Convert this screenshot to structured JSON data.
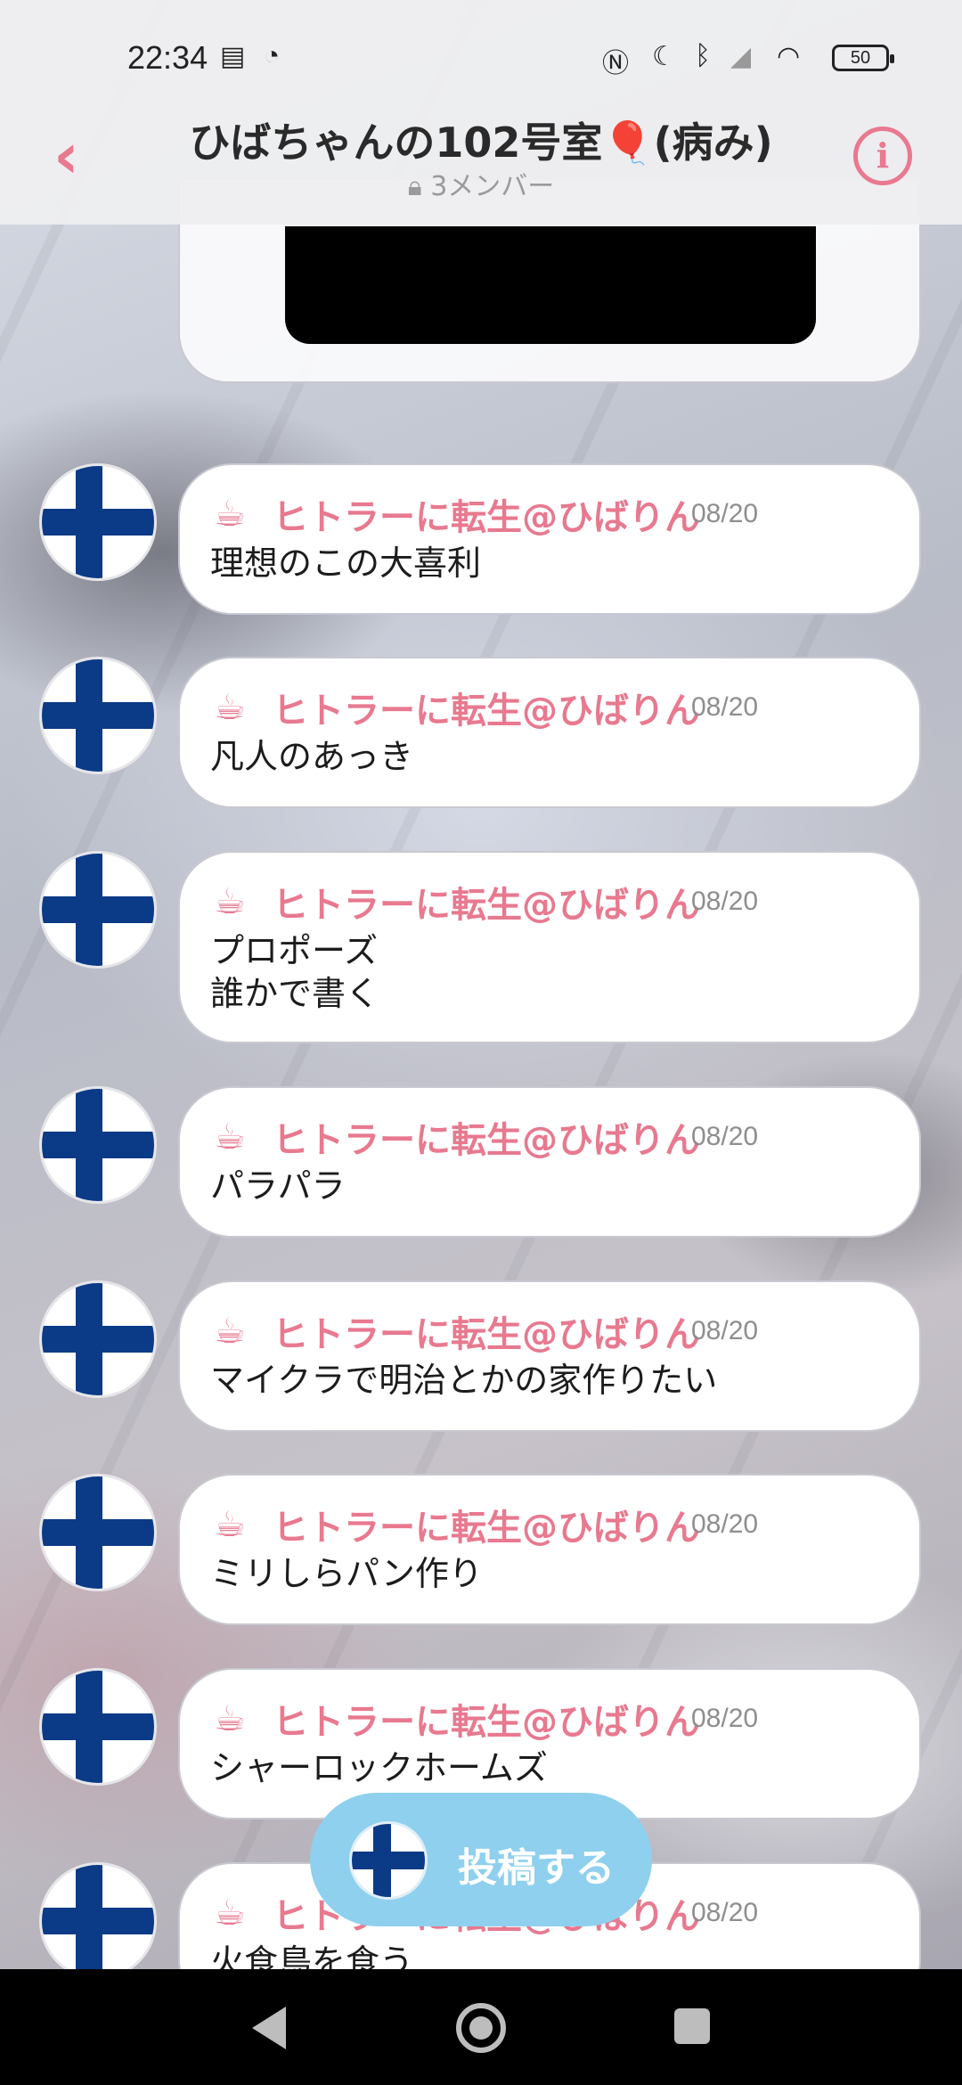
{
  "status_bar": {
    "time": "22:34",
    "battery": "50"
  },
  "header": {
    "back_icon": "chevron-left-icon",
    "title": "ひばちゃんの102号室🎈(病み)",
    "subtitle": "3メンバー",
    "info_icon": "info-icon"
  },
  "messages": [
    {
      "sender": "ヒトラーに転生@ひばりん",
      "date": "08/20",
      "text": "理想のこの大喜利"
    },
    {
      "sender": "ヒトラーに転生@ひばりん",
      "date": "08/20",
      "text": "凡人のあっき"
    },
    {
      "sender": "ヒトラーに転生@ひばりん",
      "date": "08/20",
      "text": "プロポーズ\n誰かで書く"
    },
    {
      "sender": "ヒトラーに転生@ひばりん",
      "date": "08/20",
      "text": "パラパラ"
    },
    {
      "sender": "ヒトラーに転生@ひばりん",
      "date": "08/20",
      "text": "マイクラで明治とかの家作りたい"
    },
    {
      "sender": "ヒトラーに転生@ひばりん",
      "date": "08/20",
      "text": "ミリしらパン作り"
    },
    {
      "sender": "ヒトラーに転生@ひばりん",
      "date": "08/20",
      "text": "シャーロックホームズ"
    },
    {
      "sender": "ヒトラーに転生@ひばりん",
      "date": "08/20",
      "text": "火食鳥を食う"
    }
  ],
  "post_button": {
    "label": "投稿する"
  },
  "colors": {
    "accent_pink": "#e8798f",
    "post_button": "#8fd0ee",
    "flag_blue": "#0b3a86"
  }
}
